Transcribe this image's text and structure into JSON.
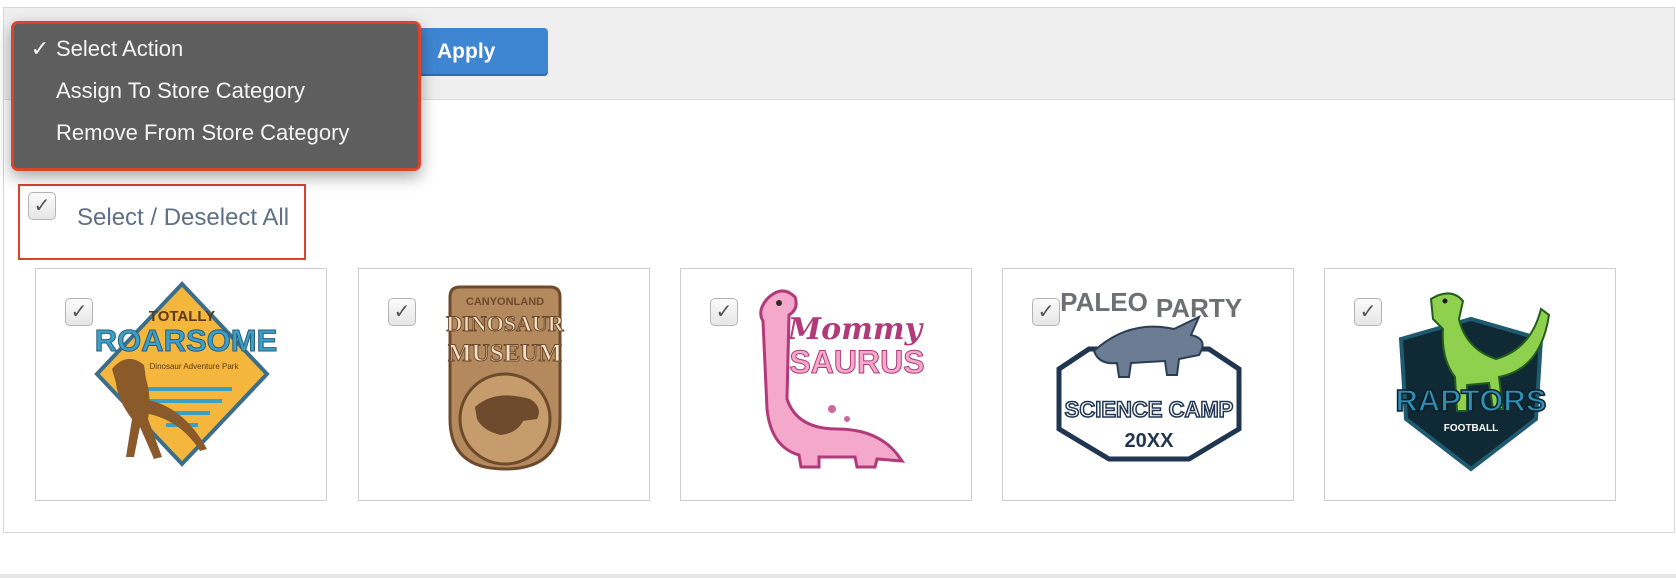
{
  "toolbar": {
    "apply_label": "Apply",
    "action_menu": {
      "items": [
        {
          "label": "Select Action",
          "selected": true
        },
        {
          "label": "Assign To Store Category",
          "selected": false
        },
        {
          "label": "Remove From Store Category",
          "selected": false
        }
      ],
      "check_glyph": "✓"
    }
  },
  "select_all": {
    "label": "Select / Deselect All",
    "checked": true
  },
  "designs": [
    {
      "checked": true,
      "art": {
        "line1": "TOTALLY",
        "line2": "ROARSOME",
        "line3": "Dinosaur Adventure Park"
      }
    },
    {
      "checked": true,
      "art": {
        "line1": "CANYONLAND",
        "line2": "DINOSAUR",
        "line3": "MUSEUM"
      }
    },
    {
      "checked": true,
      "art": {
        "line1": "Mommy",
        "line2": "SAURUS"
      }
    },
    {
      "checked": true,
      "art": {
        "line1": "PALEO",
        "line2": "PARTY",
        "line3": "SCIENCE",
        "line4": "CAMP",
        "line5": "20XX"
      }
    },
    {
      "checked": true,
      "art": {
        "line1": "RAPTORS",
        "line2": "FOOTBALL"
      }
    }
  ],
  "colors": {
    "accent": "#3f86d2",
    "highlight": "#d9442c",
    "menu_bg": "#5e5e5e"
  }
}
